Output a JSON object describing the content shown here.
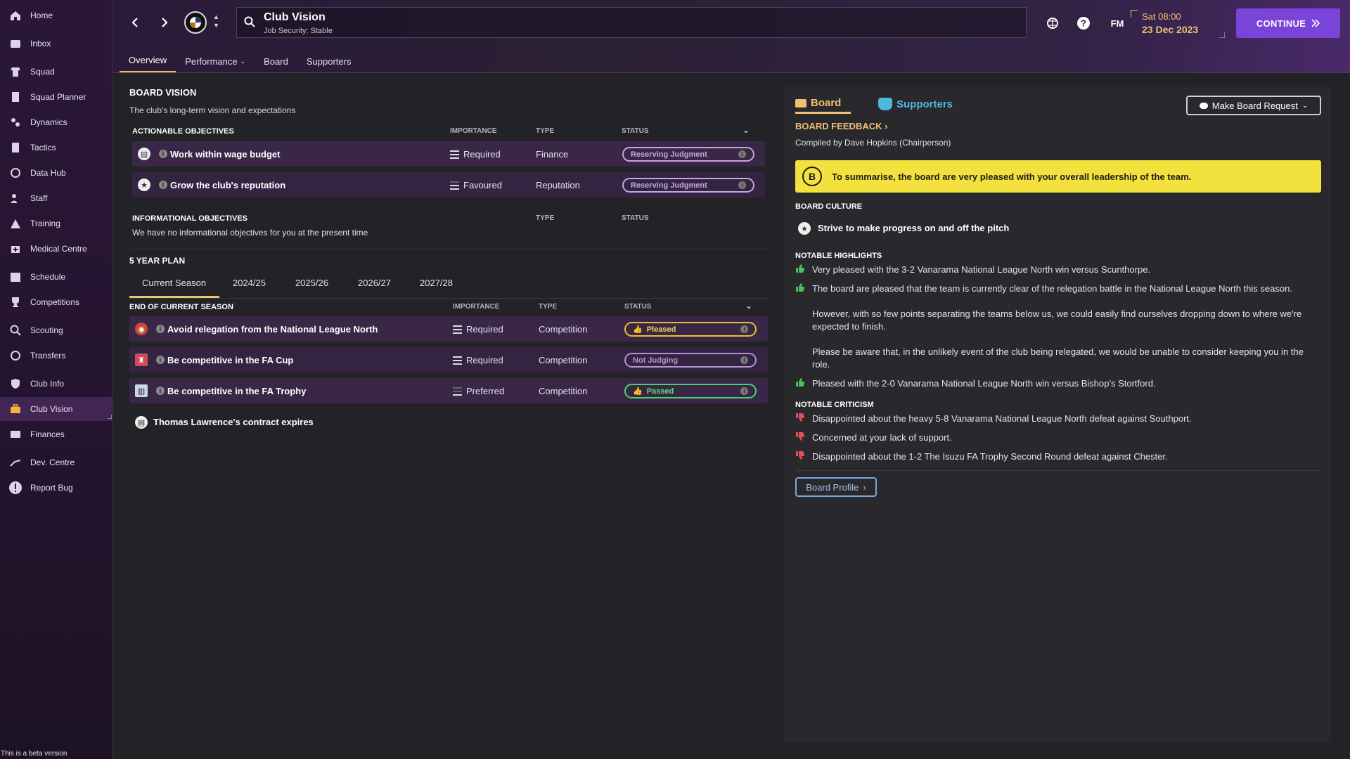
{
  "sidebar": {
    "items": [
      {
        "label": "Home",
        "icon": "home-icon"
      },
      {
        "label": "Inbox",
        "icon": "inbox-icon"
      },
      {
        "label": "Squad",
        "icon": "squad-icon"
      },
      {
        "label": "Squad Planner",
        "icon": "clipboard-icon"
      },
      {
        "label": "Dynamics",
        "icon": "dynamics-icon"
      },
      {
        "label": "Tactics",
        "icon": "tactics-icon"
      },
      {
        "label": "Data Hub",
        "icon": "data-hub-icon"
      },
      {
        "label": "Staff",
        "icon": "staff-icon"
      },
      {
        "label": "Training",
        "icon": "training-icon"
      },
      {
        "label": "Medical Centre",
        "icon": "medical-icon"
      },
      {
        "label": "Schedule",
        "icon": "calendar-icon"
      },
      {
        "label": "Competitions",
        "icon": "trophy-icon"
      },
      {
        "label": "Scouting",
        "icon": "search-icon"
      },
      {
        "label": "Transfers",
        "icon": "transfers-icon"
      },
      {
        "label": "Club Info",
        "icon": "shield-icon"
      },
      {
        "label": "Club Vision",
        "icon": "briefcase-icon"
      },
      {
        "label": "Finances",
        "icon": "finances-icon"
      },
      {
        "label": "Dev. Centre",
        "icon": "dev-centre-icon"
      },
      {
        "label": "Report Bug",
        "icon": "alert-icon"
      }
    ],
    "active": "Club Vision",
    "beta_text": "This is a beta version"
  },
  "header": {
    "title": "Club Vision",
    "subtitle": "Job Security: Stable",
    "fm_label": "FM",
    "time": "Sat 08:00",
    "date": "23 Dec 2023",
    "continue_label": "CONTINUE",
    "tabs": [
      {
        "label": "Overview"
      },
      {
        "label": "Performance"
      },
      {
        "label": "Board"
      },
      {
        "label": "Supporters"
      }
    ]
  },
  "board_vision": {
    "title": "BOARD VISION",
    "subtitle": "The club's long-term vision and expectations",
    "actionable_header": "ACTIONABLE OBJECTIVES",
    "col_importance": "IMPORTANCE",
    "col_type": "TYPE",
    "col_status": "STATUS",
    "actionable": [
      {
        "label": "Work within wage budget",
        "importance": "Required",
        "type": "Finance",
        "status": "Reserving Judgment"
      },
      {
        "label": "Grow the club's reputation",
        "importance": "Favoured",
        "type": "Reputation",
        "status": "Reserving Judgment"
      }
    ],
    "informational_header": "INFORMATIONAL OBJECTIVES",
    "informational_empty": "We have no informational objectives for you at the present time",
    "plan_title": "5 YEAR PLAN",
    "plan_tabs": [
      "Current Season",
      "2024/25",
      "2025/26",
      "2026/27",
      "2027/28"
    ],
    "season_header": "END OF CURRENT SEASON",
    "season_objectives": [
      {
        "label": "Avoid relegation from the National League North",
        "importance": "Required",
        "type": "Competition",
        "status": "Pleased"
      },
      {
        "label": "Be competitive in the FA Cup",
        "importance": "Required",
        "type": "Competition",
        "status": "Not Judging"
      },
      {
        "label": "Be competitive in the FA Trophy",
        "importance": "Preferred",
        "type": "Competition",
        "status": "Passed"
      }
    ],
    "contract_note": "Thomas Lawrence's contract expires"
  },
  "feedback": {
    "tab_board": "Board",
    "tab_supporters": "Supporters",
    "make_request": "Make Board Request",
    "title": "BOARD FEEDBACK",
    "compiled_by": "Compiled by Dave Hopkins (Chairperson)",
    "grade": "B",
    "summary": "To summarise, the board are very pleased with your overall leadership of the team.",
    "culture_header": "BOARD CULTURE",
    "culture_text": "Strive to make progress on and off the pitch",
    "highlights_header": "NOTABLE HIGHLIGHTS",
    "highlights": [
      "Very pleased with the 3-2 Vanarama National League North win versus Scunthorpe.",
      "The board are pleased that the team is currently clear of the relegation battle in the National League North this season.",
      "However, with so few points separating the teams below us, we could easily find ourselves dropping down to where we're expected to finish.",
      "Please be aware that, in the unlikely event of the club being relegated, we would be unable to consider keeping you in the role.",
      "Pleased with the 2-0 Vanarama National League North win versus Bishop's Stortford."
    ],
    "criticism_header": "NOTABLE CRITICISM",
    "criticism": [
      "Disappointed about the heavy 5-8 Vanarama National League North defeat against Southport.",
      "Concerned at your lack of support.",
      "Disappointed about the 1-2 The Isuzu FA Trophy Second Round defeat against Chester."
    ],
    "profile_button": "Board Profile"
  }
}
